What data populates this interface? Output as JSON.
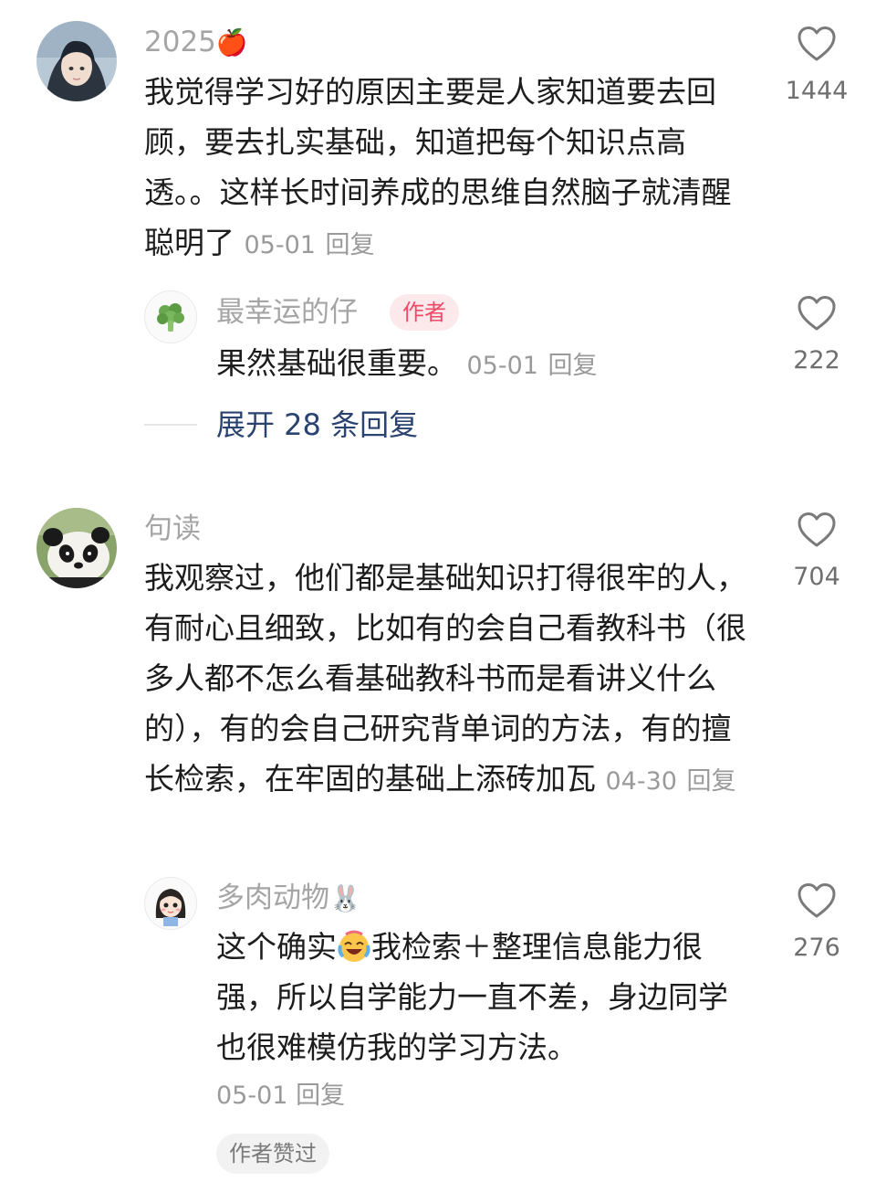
{
  "comments": [
    {
      "username": "2025",
      "username_emoji": "🍎",
      "avatar_icon": "anime-portrait-avatar",
      "text": "我觉得学习好的原因主要是人家知道要去回顾，要去扎实基础，知道把每个知识点高透。。这样长时间养成的思维自然脑子就清醒聪明了",
      "date": "05-01",
      "reply_label": "回复",
      "likes": "1444",
      "replies": [
        {
          "username": "最幸运的仔",
          "badge": "作者",
          "avatar_icon": "broccoli-avatar",
          "text": "果然基础很重要。",
          "date": "05-01",
          "reply_label": "回复",
          "likes": "222"
        }
      ],
      "expand_label": "展开 28 条回复"
    },
    {
      "username": "句读",
      "avatar_icon": "panda-avatar",
      "text": "我观察过，他们都是基础知识打得很牢的人，有耐心且细致，比如有的会自己看教科书（很多人都不怎么看基础教科书而是看讲义什么的），有的会自己研究背单词的方法，有的擅长检索，在牢固的基础上添砖加瓦",
      "date": "04-30",
      "reply_label": "回复",
      "likes": "704",
      "replies": [
        {
          "username": "多肉动物",
          "username_emoji": "🐰",
          "avatar_icon": "cartoon-girl-avatar",
          "text_before_emoji": "这个确实",
          "inline_emoji": "crying-laughing-emoji",
          "text_after_emoji": "我检索＋整理信息能力很强，所以自学能力一直不差，身边同学也很难模仿我的学习方法。",
          "date": "05-01",
          "reply_label": "回复",
          "likes": "276",
          "liked_by_author": "作者赞过"
        }
      ]
    }
  ],
  "colors": {
    "username": "#a5a5a5",
    "badge_bg": "#fbe9ec",
    "badge_text": "#ef4a66",
    "expand_text": "#2a4370",
    "meta": "#9a9a9a"
  }
}
